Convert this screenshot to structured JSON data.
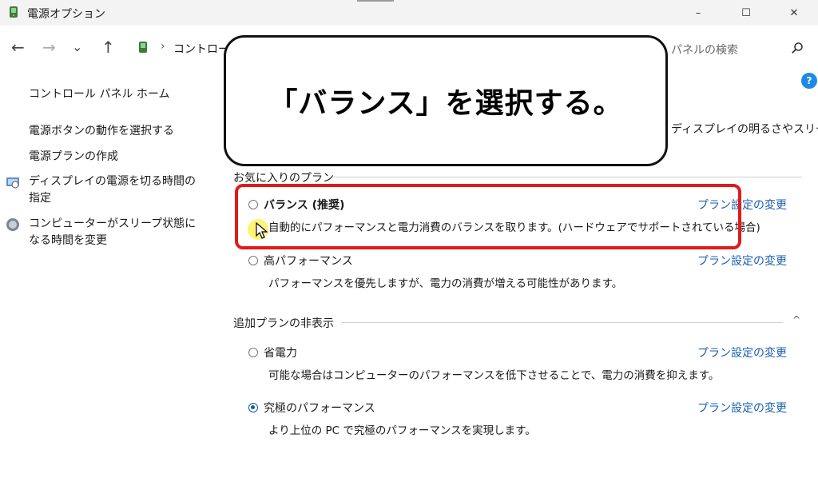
{
  "window": {
    "title": "電源オプション",
    "controls": {
      "minimize": "–",
      "maximize": "☐",
      "close": "✕"
    }
  },
  "nav": {
    "back": "←",
    "forward": "→",
    "recent": "⌄",
    "up": "↑"
  },
  "address": {
    "separator": "›",
    "path": "コントロール"
  },
  "search": {
    "placeholder": "パネルの検索"
  },
  "help": {
    "label": "?"
  },
  "sidebar": {
    "home": "コントロール パネル ホーム",
    "items": [
      "電源ボタンの動作を選択する",
      "電源プランの作成",
      "ディスプレイの電源を切る時間の指定",
      "コンピューターがスリープ状態になる時間を変更"
    ]
  },
  "main": {
    "truncated_text": "ディスプレイの明るさやスリー",
    "favorites_header": "お気に入りのプラン",
    "hidden_header": "追加プランの非表示",
    "collapse_icon": "^",
    "plans": [
      {
        "name": "バランス (推奨)",
        "desc": "自動的にパフォーマンスと電力消費のバランスを取ります。(ハードウェアでサポートされている場合)",
        "link": "プラン設定の変更",
        "selected": false
      },
      {
        "name": "高パフォーマンス",
        "desc": "パフォーマンスを優先しますが、電力の消費が増える可能性があります。",
        "link": "プラン設定の変更",
        "selected": false
      },
      {
        "name": "省電力",
        "desc": "可能な場合はコンピューターのパフォーマンスを低下させることで、電力の消費を抑えます。",
        "link": "プラン設定の変更",
        "selected": false
      },
      {
        "name": "究極のパフォーマンス",
        "desc": "より上位の PC で究極のパフォーマンスを実現します。",
        "link": "プラン設定の変更",
        "selected": true
      }
    ]
  },
  "callout": {
    "text": "「バランス」を選択する。"
  },
  "colors": {
    "accent": "#1a5fb4",
    "highlight": "#e11a1a",
    "radio_selected": "#0b5cad"
  }
}
